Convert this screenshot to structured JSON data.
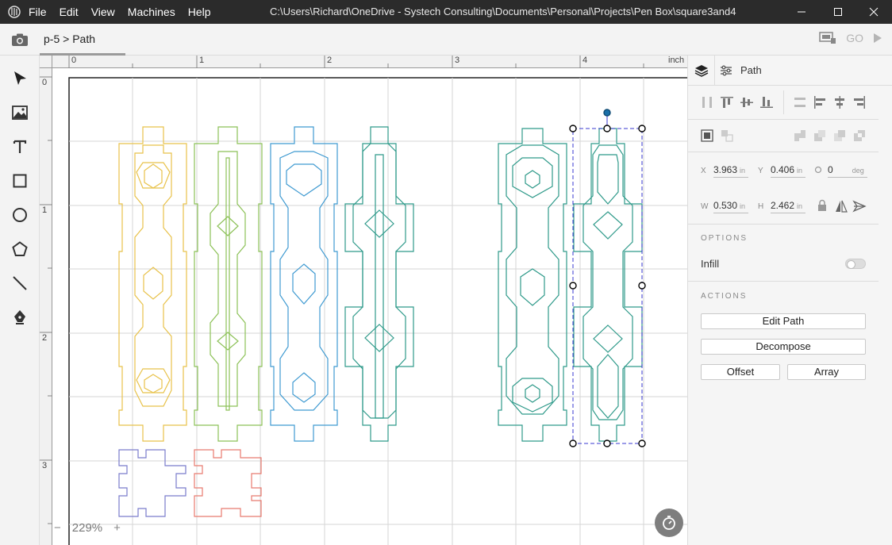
{
  "menu": [
    "File",
    "Edit",
    "View",
    "Machines",
    "Help"
  ],
  "window_title": "C:\\Users\\Richard\\OneDrive - Systech Consulting\\Documents\\Personal\\Projects\\Pen Box\\square3and4",
  "breadcrumb": "p-5 > Path",
  "go_label": "GO",
  "ruler": {
    "unit": "inch",
    "top_labels": [
      "0",
      "1",
      "2",
      "3",
      "4"
    ],
    "left_labels": [
      "0",
      "1",
      "2",
      "3"
    ]
  },
  "zoom": {
    "minus": "−",
    "value": "229%",
    "plus": "+"
  },
  "panel": {
    "tab_label": "Path",
    "x_label": "X",
    "x_value": "3.963",
    "x_unit": "in",
    "y_label": "Y",
    "y_value": "0.406",
    "y_unit": "in",
    "rot_value": "0",
    "rot_unit": "deg",
    "w_label": "W",
    "w_value": "0.530",
    "w_unit": "in",
    "h_label": "H",
    "h_value": "2.462",
    "h_unit": "in",
    "options_title": "OPTIONS",
    "infill_label": "Infill",
    "actions_title": "ACTIONS",
    "edit_path": "Edit Path",
    "decompose": "Decompose",
    "offset": "Offset",
    "array": "Array"
  },
  "colors": {
    "yellow": "#e8c24a",
    "green": "#8cc157",
    "blue": "#3f9ad1",
    "teal": "#2f9a8a",
    "purple": "#7a7ccc",
    "red": "#e87a6f",
    "selection": "#3a3ad0"
  }
}
